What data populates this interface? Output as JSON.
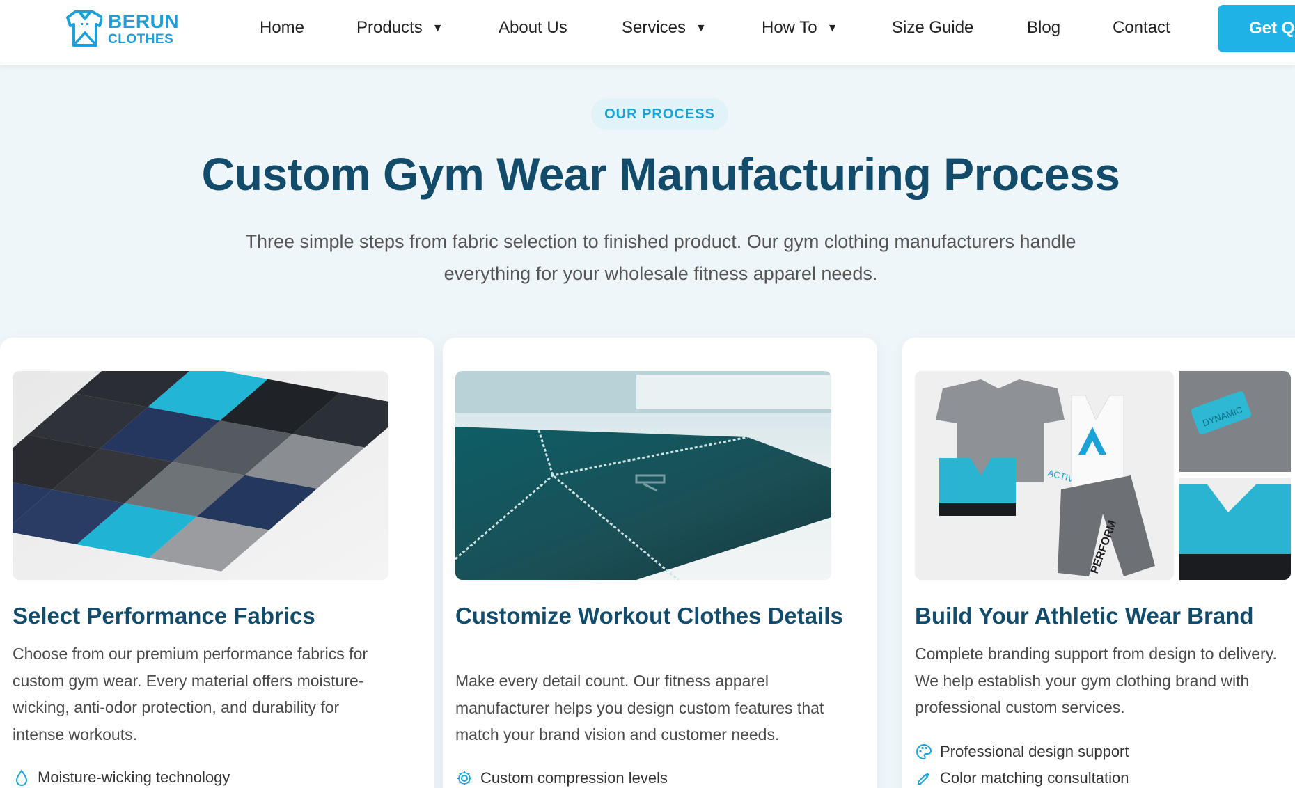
{
  "logo": {
    "line1": "BERUN",
    "line2": "CLOTHES"
  },
  "nav": {
    "items": [
      {
        "label": "Home"
      },
      {
        "label": "Products",
        "caret": "▼"
      },
      {
        "label": "About Us"
      },
      {
        "label": "Services",
        "caret": "▼"
      },
      {
        "label": "How To",
        "caret": "▼"
      },
      {
        "label": "Size Guide"
      },
      {
        "label": "Blog"
      },
      {
        "label": "Contact"
      }
    ],
    "cta_label": "Get Q"
  },
  "hero": {
    "eyebrow": "OUR PROCESS",
    "title": "Custom Gym Wear Manufacturing Process",
    "subtitle": "Three simple steps from fabric selection to finished product. Our gym clothing manufacturers handle everything for your wholesale fitness apparel needs."
  },
  "cards": [
    {
      "title": "Select Performance Fabrics",
      "description": "Choose from our premium performance fabrics for custom gym wear. Every material offers moisture-wicking, anti-odor protection, and durability for intense workouts.",
      "features": [
        {
          "icon": "water-drop-icon",
          "label": "Moisture-wicking technology"
        }
      ]
    },
    {
      "title": "Customize Workout Clothes Details",
      "description": "Make every detail count. Our fitness apparel manufacturer helps you design custom features that match your brand vision and customer needs.",
      "features": [
        {
          "icon": "gear-icon",
          "label": "Custom compression levels"
        }
      ]
    },
    {
      "title": "Build Your Athletic Wear Brand",
      "description": "Complete branding support from design to delivery. We help establish your gym clothing brand with professional custom services.",
      "features": [
        {
          "icon": "palette-icon",
          "label": "Professional design support"
        },
        {
          "icon": "eyedropper-icon",
          "label": "Color matching consultation"
        }
      ],
      "image_labels": {
        "tee": "ACTIVEWEAR",
        "pants": "PERFORM",
        "patch": "DYNAMIC"
      }
    }
  ],
  "colors": {
    "brand": "#1e9fd8",
    "heading": "#124c6a",
    "accent": "#1eb2e6",
    "page_bg": "#eef6f9"
  }
}
